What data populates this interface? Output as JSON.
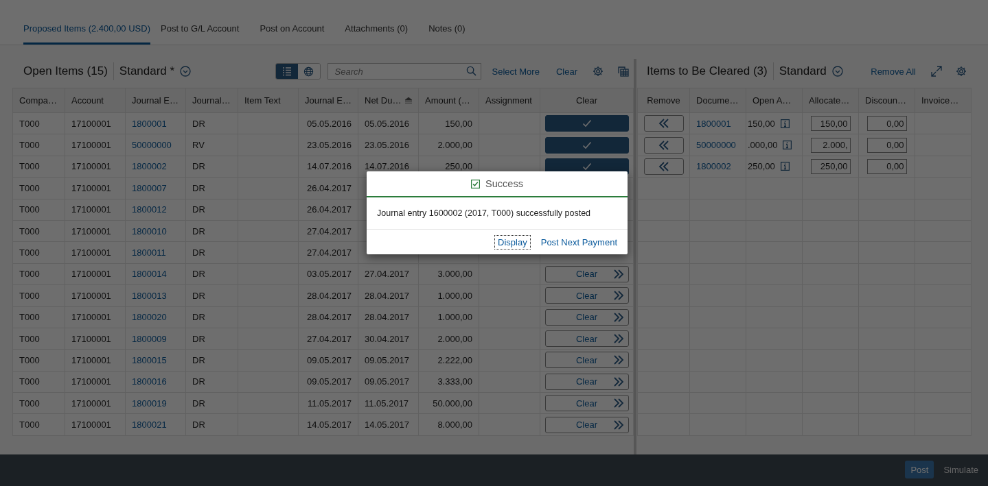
{
  "tabs": [
    {
      "label": "Proposed Items (2.400,00 USD)",
      "selected": true
    },
    {
      "label": "Post to G/L Account",
      "selected": false
    },
    {
      "label": "Post on Account",
      "selected": false
    },
    {
      "label": "Attachments (0)",
      "selected": false
    },
    {
      "label": "Notes (0)",
      "selected": false
    }
  ],
  "open_items": {
    "title": "Open Items (15)",
    "variant": "Standard *",
    "view_toggle": [
      {
        "kind": "list",
        "selected": true
      },
      {
        "kind": "globe",
        "selected": false
      }
    ],
    "search": {
      "placeholder": "Search"
    },
    "actions": [
      "Select More",
      "Clear"
    ],
    "columns": [
      {
        "label": "Compa…",
        "sorted": false
      },
      {
        "label": "Account",
        "sorted": false
      },
      {
        "label": "Journal E…",
        "sorted": false
      },
      {
        "label": "Journal…",
        "sorted": false
      },
      {
        "label": "Item Text",
        "sorted": false
      },
      {
        "label": "Journal E…",
        "sorted": false
      },
      {
        "label": "Net Du…",
        "sorted": true
      },
      {
        "label": "Amount (…",
        "sorted": false
      },
      {
        "label": "Assignment",
        "sorted": false
      },
      {
        "label": "Clear",
        "sorted": false
      }
    ],
    "rows": [
      {
        "company": "T000",
        "account": "17100001",
        "journal_entry": "1800001",
        "journal_type": "DR",
        "posting_date": "05.05.2016",
        "net_due": "05.05.2016",
        "amount": "150,00",
        "clear": {
          "selected": true
        }
      },
      {
        "company": "T000",
        "account": "17100001",
        "journal_entry": "50000000",
        "journal_type": "RV",
        "posting_date": "23.05.2016",
        "net_due": "23.05.2016",
        "amount": "2.000,00",
        "clear": {
          "selected": true
        }
      },
      {
        "company": "T000",
        "account": "17100001",
        "journal_entry": "1800002",
        "journal_type": "DR",
        "posting_date": "14.07.2016",
        "net_due": "14.07.2016",
        "amount": "250,00",
        "clear": {
          "selected": true
        }
      },
      {
        "company": "T000",
        "account": "17100001",
        "journal_entry": "1800007",
        "journal_type": "DR",
        "posting_date": "26.04.2017"
      },
      {
        "company": "T000",
        "account": "17100001",
        "journal_entry": "1800012",
        "journal_type": "DR",
        "posting_date": "26.04.2017"
      },
      {
        "company": "T000",
        "account": "17100001",
        "journal_entry": "1800010",
        "journal_type": "DR",
        "posting_date": "27.04.2017"
      },
      {
        "company": "T000",
        "account": "17100001",
        "journal_entry": "1800011",
        "journal_type": "DR",
        "posting_date": "27.04.2017"
      },
      {
        "company": "T000",
        "account": "17100001",
        "journal_entry": "1800014",
        "journal_type": "DR",
        "posting_date": "03.05.2017",
        "net_due": "27.04.2017",
        "amount": "3.000,00",
        "clear": {
          "selected": false,
          "label": "Clear"
        }
      },
      {
        "company": "T000",
        "account": "17100001",
        "journal_entry": "1800013",
        "journal_type": "DR",
        "posting_date": "28.04.2017",
        "net_due": "28.04.2017",
        "amount": "1.000,00",
        "clear": {
          "selected": false,
          "label": "Clear"
        }
      },
      {
        "company": "T000",
        "account": "17100001",
        "journal_entry": "1800020",
        "journal_type": "DR",
        "posting_date": "28.04.2017",
        "net_due": "28.04.2017",
        "amount": "1.000,00",
        "clear": {
          "selected": false,
          "label": "Clear"
        }
      },
      {
        "company": "T000",
        "account": "17100001",
        "journal_entry": "1800009",
        "journal_type": "DR",
        "posting_date": "27.04.2017",
        "net_due": "30.04.2017",
        "amount": "2.000,00",
        "clear": {
          "selected": false,
          "label": "Clear"
        }
      },
      {
        "company": "T000",
        "account": "17100001",
        "journal_entry": "1800015",
        "journal_type": "DR",
        "posting_date": "09.05.2017",
        "net_due": "09.05.2017",
        "amount": "2.222,00",
        "clear": {
          "selected": false,
          "label": "Clear"
        }
      },
      {
        "company": "T000",
        "account": "17100001",
        "journal_entry": "1800016",
        "journal_type": "DR",
        "posting_date": "09.05.2017",
        "net_due": "09.05.2017",
        "amount": "3.333,00",
        "clear": {
          "selected": false,
          "label": "Clear"
        }
      },
      {
        "company": "T000",
        "account": "17100001",
        "journal_entry": "1800019",
        "journal_type": "DR",
        "posting_date": "11.05.2017",
        "net_due": "11.05.2017",
        "amount": "50.000,00",
        "clear": {
          "selected": false,
          "label": "Clear"
        }
      },
      {
        "company": "T000",
        "account": "17100001",
        "journal_entry": "1800021",
        "journal_type": "DR",
        "posting_date": "14.05.2017",
        "net_due": "14.05.2017",
        "amount": "8.000,00",
        "clear": {
          "selected": false,
          "label": "Clear"
        }
      }
    ]
  },
  "items_to_clear": {
    "title": "Items to Be Cleared (3)",
    "variant": "Standard",
    "action": "Remove All",
    "columns": [
      {
        "label": "Remove"
      },
      {
        "label": "Docume…"
      },
      {
        "label": "Open A…"
      },
      {
        "label": "Allocate…"
      },
      {
        "label": "Discoun…"
      },
      {
        "label": "Invoice…"
      }
    ],
    "rows": [
      {
        "document": "1800001",
        "open_amount": "150,00",
        "allocated": "150,00",
        "discount": "0,00"
      },
      {
        "document": "50000000",
        "open_amount": ".000,00",
        "allocated": "2.000,",
        "discount": "0,00"
      },
      {
        "document": "1800002",
        "open_amount": "250,00",
        "allocated": "250,00",
        "discount": "0,00"
      }
    ]
  },
  "footer": {
    "buttons": [
      {
        "label": "Post",
        "kind": "emphasized"
      },
      {
        "label": "Simulate",
        "kind": "transparent"
      }
    ]
  },
  "dialog": {
    "title": "Success",
    "message": "Journal entry 1600002 (2017, T000) successfully posted",
    "buttons": [
      {
        "label": "Display",
        "focused": true
      },
      {
        "label": "Post Next Payment",
        "focused": false
      }
    ]
  }
}
